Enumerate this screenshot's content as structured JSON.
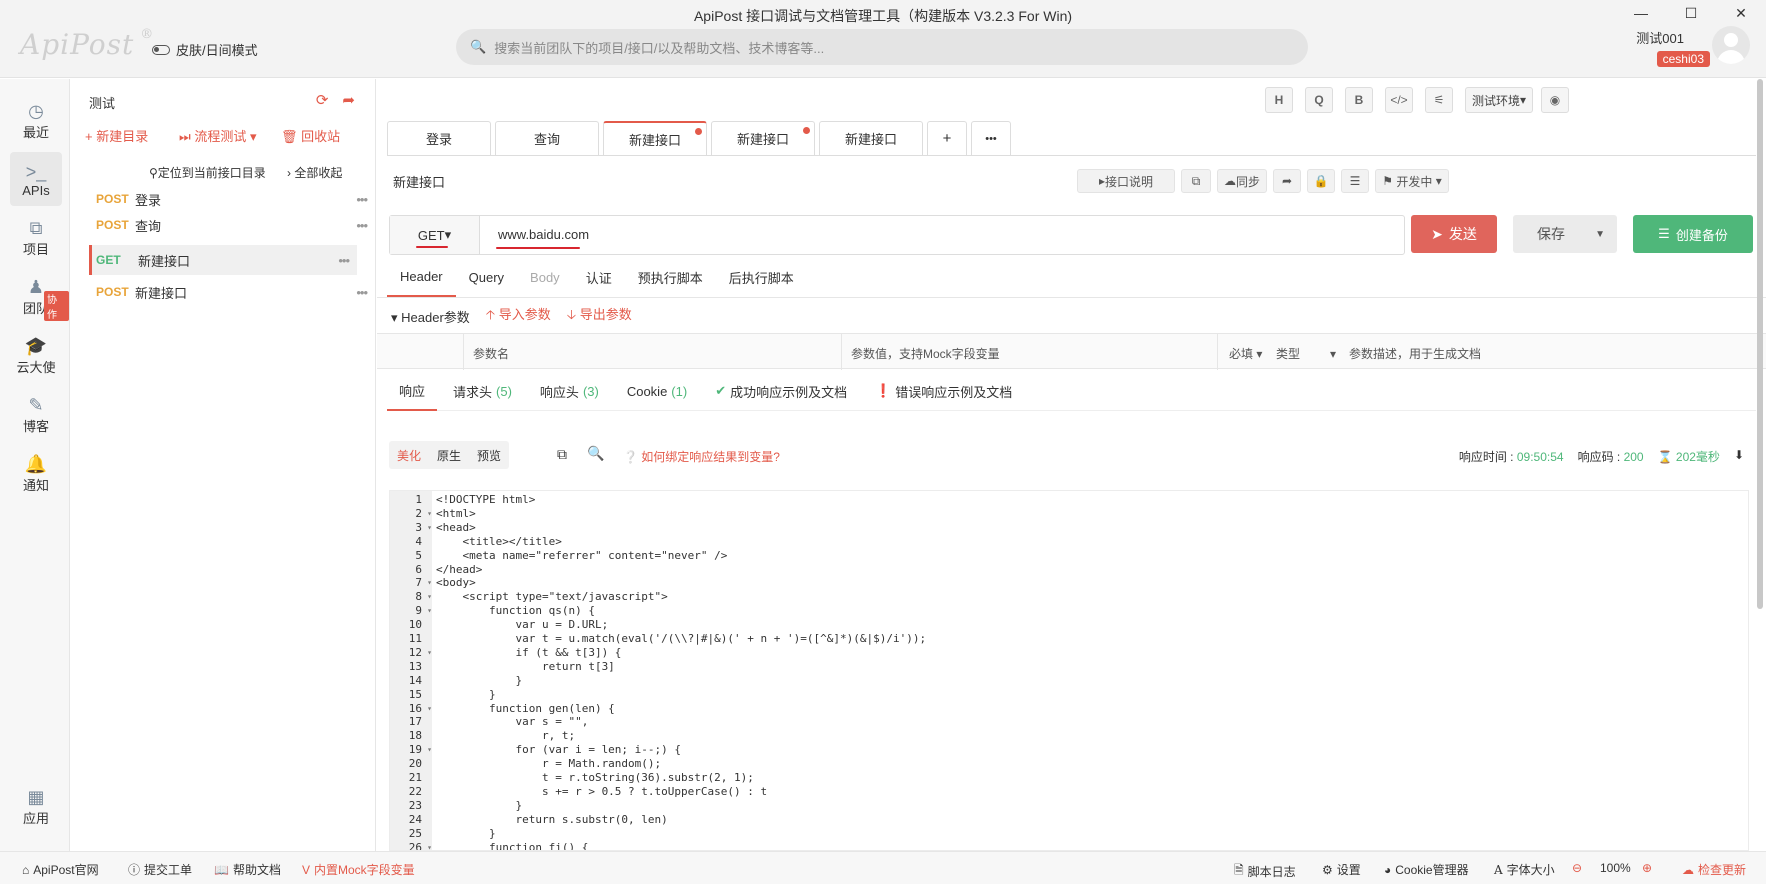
{
  "window": {
    "title": "ApiPost 接口调试与文档管理工具（构建版本 V3.2.3 For Win)",
    "controls": [
      "—",
      "☐",
      "✕"
    ]
  },
  "app": {
    "logo": "ApiPost",
    "logo_mark": "®",
    "skin_label": "皮肤/日间模式",
    "search_placeholder": "搜索当前团队下的项目/接口/以及帮助文档、技术博客等...",
    "user_name": "测试001",
    "user_tag": "ceshi03"
  },
  "nav": {
    "items": [
      {
        "label": "最近",
        "icon": "clock-icon"
      },
      {
        "label": "APIs",
        "icon": "terminal-icon"
      },
      {
        "label": "项目",
        "icon": "project-icon"
      },
      {
        "label": "团队",
        "icon": "team-icon"
      },
      {
        "label": "云大使",
        "icon": "graduation-icon"
      },
      {
        "label": "博客",
        "icon": "edit-icon"
      },
      {
        "label": "通知",
        "icon": "bell-icon"
      },
      {
        "label": "应用",
        "icon": "apps-icon"
      }
    ],
    "team_badge": "协作"
  },
  "tree": {
    "project": "测试",
    "new_dir": "+ 新建目录",
    "flow_test": "流程测试",
    "recycle": "回收站",
    "locate": "定位到当前接口目录",
    "collapse_all": "全部收起",
    "apis": [
      {
        "method": "POST",
        "name": "登录",
        "color": "#e8a43a"
      },
      {
        "method": "POST",
        "name": "查询",
        "color": "#e8a43a"
      },
      {
        "method": "GET",
        "name": "新建接口",
        "color": "#4fb77a"
      },
      {
        "method": "POST",
        "name": "新建接口",
        "color": "#e8a43a"
      }
    ],
    "more": "•••"
  },
  "toolbar": {
    "h": "H",
    "q": "Q",
    "b": "B",
    "code": "</>",
    "filter": "⚟",
    "env": "测试环境",
    "eye": "◉"
  },
  "tabs": [
    {
      "label": "登录",
      "dot": false
    },
    {
      "label": "查询",
      "dot": false
    },
    {
      "label": "新建接口",
      "dot": true,
      "active": true
    },
    {
      "label": "新建接口",
      "dot": true
    },
    {
      "label": "新建接口",
      "dot": false
    }
  ],
  "tab_add": "+",
  "tab_more": "•••",
  "request": {
    "name": "新建接口",
    "doc_btn": "接口说明",
    "sync_btn": "同步",
    "status": "开发中",
    "method": "GET",
    "url": "www.baidu.com",
    "send": "发送",
    "save": "保存",
    "backup": "创建备份"
  },
  "req_tabs": [
    "Header",
    "Query",
    "Body",
    "认证",
    "预执行脚本",
    "后执行脚本"
  ],
  "header_params": {
    "title": "Header参数",
    "import": "导入参数",
    "export": "导出参数",
    "col_name": "参数名",
    "col_value": "参数值，支持Mock字段变量",
    "col_required": "必填",
    "col_type": "类型",
    "col_desc": "参数描述，用于生成文档"
  },
  "resp_tabs": {
    "resp": "响应",
    "req_head": "请求头",
    "req_head_n": "(5)",
    "resp_head": "响应头",
    "resp_head_n": "(3)",
    "cookie": "Cookie",
    "cookie_n": "(1)",
    "success_doc": "成功响应示例及文档",
    "error_doc": "错误响应示例及文档"
  },
  "view": {
    "pretty": "美化",
    "raw": "原生",
    "preview": "预览",
    "bind_hint": "如何绑定响应结果到变量?"
  },
  "resp_meta": {
    "time_label": "响应时间 :",
    "time": "09:50:54",
    "code_label": "响应码 :",
    "code": "200",
    "duration": "202毫秒"
  },
  "code_lines": [
    "<!DOCTYPE html>",
    "<html>",
    "<head>",
    "    <title></title>",
    "    <meta name=\"referrer\" content=\"never\" />",
    "</head>",
    "<body>",
    "    <script type=\"text/javascript\">",
    "        function qs(n) {",
    "            var u = D.URL;",
    "            var t = u.match(eval('/(\\\\?|#|&)(' + n + ')=([^&]*)(&|$)/i'));",
    "            if (t && t[3]) {",
    "                return t[3]",
    "            }",
    "        }",
    "        function gen(len) {",
    "            var s = \"\",",
    "                r, t;",
    "            for (var i = len; i--;) {",
    "                r = Math.random();",
    "                t = r.toString(36).substr(2, 1);",
    "                s += r > 0.5 ? t.toUpperCase() : t",
    "            }",
    "            return s.substr(0, len)",
    "        }",
    "        function fi() {"
  ],
  "fold_lines": [
    2,
    3,
    7,
    8,
    9,
    12,
    16,
    19,
    26
  ],
  "status": {
    "site": "ApiPost官网",
    "ticket": "提交工单",
    "help": "帮助文档",
    "mock": "内置Mock字段变量",
    "log": "脚本日志",
    "settings": "设置",
    "cookie": "Cookie管理器",
    "font": "字体大小",
    "zoom": "100%",
    "update": "检查更新"
  }
}
